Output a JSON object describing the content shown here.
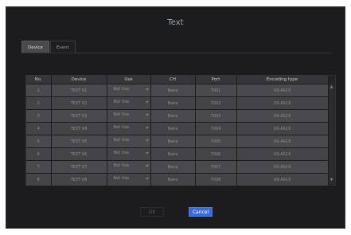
{
  "dialog": {
    "title": "Text",
    "tabs": [
      {
        "label": "Device",
        "active": true
      },
      {
        "label": "Event",
        "active": false
      }
    ]
  },
  "table": {
    "columns": [
      "No.",
      "Device",
      "Use",
      "CH",
      "Port",
      "Encoding type"
    ],
    "rows": [
      {
        "no": "1",
        "device": "TEXT 01",
        "use": "Not Use",
        "ch": "None",
        "port": "7001",
        "encoding": "US-ASCII"
      },
      {
        "no": "2",
        "device": "TEXT 02",
        "use": "Not Use",
        "ch": "None",
        "port": "7002",
        "encoding": "US-ASCII"
      },
      {
        "no": "3",
        "device": "TEXT 03",
        "use": "Not Use",
        "ch": "None",
        "port": "7003",
        "encoding": "US-ASCII"
      },
      {
        "no": "4",
        "device": "TEXT 04",
        "use": "Not Use",
        "ch": "None",
        "port": "7004",
        "encoding": "US-ASCII"
      },
      {
        "no": "5",
        "device": "TEXT 05",
        "use": "Not Use",
        "ch": "None",
        "port": "7005",
        "encoding": "US-ASCII"
      },
      {
        "no": "6",
        "device": "TEXT 06",
        "use": "Not Use",
        "ch": "None",
        "port": "7006",
        "encoding": "US-ASCII"
      },
      {
        "no": "7",
        "device": "TEXT 07",
        "use": "Not Use",
        "ch": "None",
        "port": "7007",
        "encoding": "US-ASCII"
      },
      {
        "no": "8",
        "device": "TEXT 08",
        "use": "Not Use",
        "ch": "None",
        "port": "7008",
        "encoding": "US-ASCII"
      }
    ]
  },
  "footer": {
    "ok_label": "OK",
    "cancel_label": "Cancel"
  },
  "colors": {
    "background": "#1c1c1e",
    "header": "#36363a",
    "row": "#4a4a4e",
    "accent": "#3a6cd8"
  }
}
